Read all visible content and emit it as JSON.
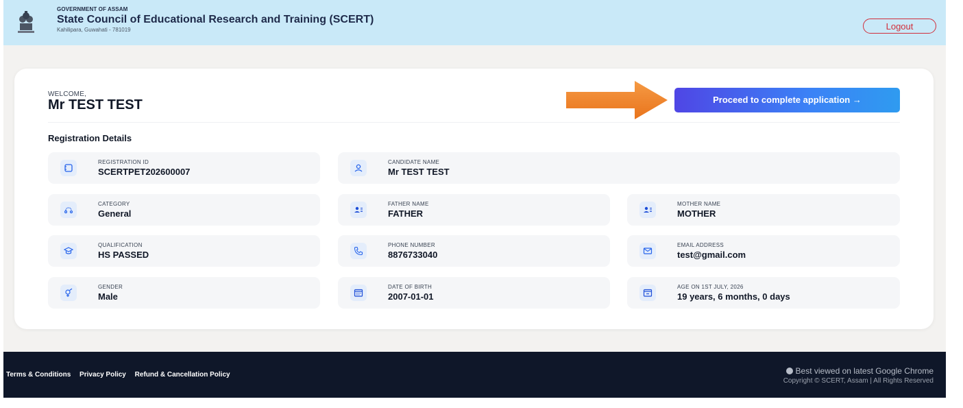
{
  "header": {
    "gov_line": "GOVERNMENT OF ASSAM",
    "org_title": "State Council of Educational Research and Training (SCERT)",
    "org_address": "Kahilipara, Guwahati - 781019",
    "logout_label": "Logout"
  },
  "welcome": {
    "label": "WELCOME,",
    "name": "Mr TEST TEST",
    "proceed_label": "Proceed to complete application  →"
  },
  "details": {
    "section_title": "Registration Details",
    "fields": [
      {
        "label": "REGISTRATION ID",
        "value": "SCERTPET202600007",
        "icon": "id-card-icon"
      },
      {
        "label": "CANDIDATE NAME",
        "value": "Mr TEST TEST",
        "icon": "user-icon"
      },
      {
        "label": "CATEGORY",
        "value": "General",
        "icon": "route-icon"
      },
      {
        "label": "FATHER NAME",
        "value": "FATHER",
        "icon": "contact-card-icon"
      },
      {
        "label": "MOTHER NAME",
        "value": "MOTHER",
        "icon": "contact-card-icon"
      },
      {
        "label": "QUALIFICATION",
        "value": "HS PASSED",
        "icon": "graduation-cap-icon"
      },
      {
        "label": "PHONE NUMBER",
        "value": "8876733040",
        "icon": "phone-icon"
      },
      {
        "label": "EMAIL ADDRESS",
        "value": "test@gmail.com",
        "icon": "mail-icon"
      },
      {
        "label": "GENDER",
        "value": "Male",
        "icon": "gender-icon"
      },
      {
        "label": "DATE OF BIRTH",
        "value": "2007-01-01",
        "icon": "calendar-icon"
      },
      {
        "label": "AGE ON 1ST JULY, 2026",
        "value": "19 years, 6 months, 0 days",
        "icon": "calendar-blank-icon"
      }
    ]
  },
  "footer": {
    "links": [
      "Terms & Conditions",
      "Privacy Policy",
      "Refund & Cancellation Policy"
    ],
    "browser_note": "Best viewed on latest Google Chrome",
    "copyright": "Copyright © SCERT, Assam | All Rights Reserved"
  },
  "colors": {
    "header_bg": "#c9e9f8",
    "accent_button": "#4f46e5",
    "logout": "#d12e3a",
    "arrow": "#f07f23",
    "footer_bg": "#0f1729"
  }
}
